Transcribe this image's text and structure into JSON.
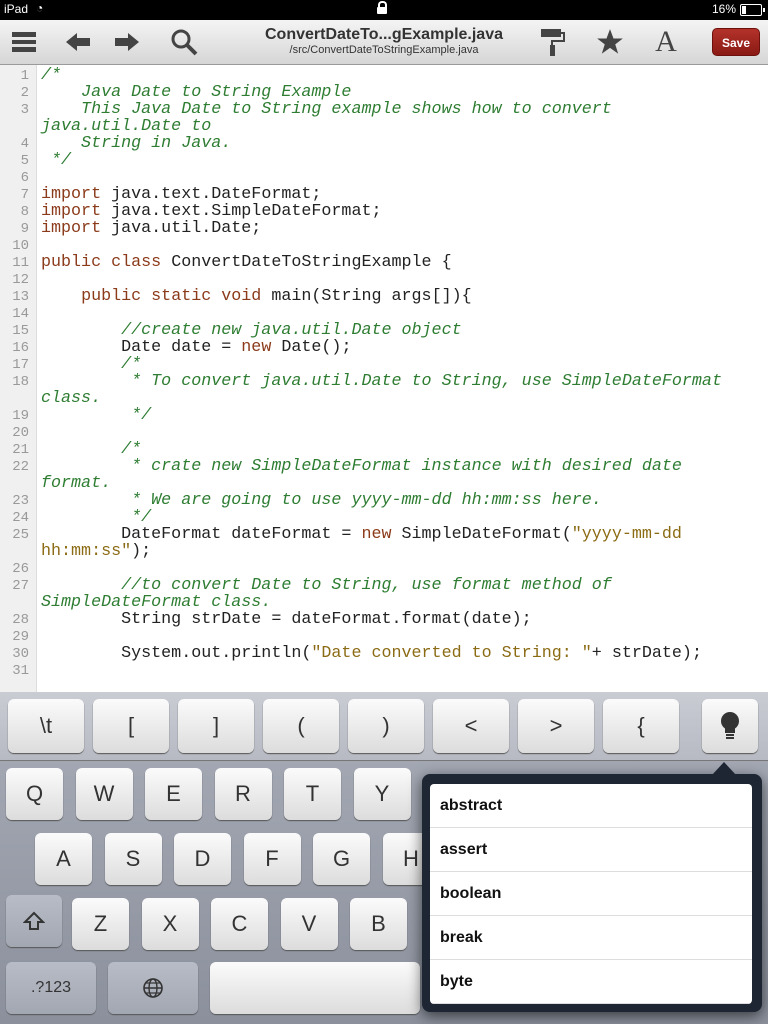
{
  "status": {
    "device": "iPad",
    "battery": "16%"
  },
  "toolbar": {
    "title": "ConvertDateTo...gExample.java",
    "path": "/src/ConvertDateToStringExample.java",
    "save_label": "Save",
    "icons": [
      "menu-icon",
      "back-icon",
      "forward-icon",
      "search-icon",
      "paint-roller-icon",
      "star-icon",
      "font-icon"
    ]
  },
  "code": {
    "lines": [
      {
        "n": "1",
        "parts": [
          [
            "cm",
            "/*"
          ]
        ]
      },
      {
        "n": "2",
        "parts": [
          [
            "cm",
            "    Java Date to String Example"
          ]
        ]
      },
      {
        "n": "3",
        "parts": [
          [
            "cm",
            "    This Java Date to String example shows how to convert"
          ]
        ]
      },
      {
        "n": "",
        "parts": [
          [
            "cm",
            "java.util.Date to"
          ]
        ]
      },
      {
        "n": "4",
        "parts": [
          [
            "cm",
            "    String in Java."
          ]
        ]
      },
      {
        "n": "5",
        "parts": [
          [
            "cm",
            " */"
          ]
        ]
      },
      {
        "n": "6",
        "parts": []
      },
      {
        "n": "7",
        "parts": [
          [
            "kw",
            "import"
          ],
          [
            "",
            "java.text.DateFormat;"
          ]
        ]
      },
      {
        "n": "8",
        "parts": [
          [
            "kw",
            "import"
          ],
          [
            "",
            "java.text.SimpleDateFormat;"
          ]
        ]
      },
      {
        "n": "9",
        "parts": [
          [
            "kw",
            "import"
          ],
          [
            "",
            "java.util.Date;"
          ]
        ]
      },
      {
        "n": "10",
        "parts": []
      },
      {
        "n": "11",
        "parts": [
          [
            "kw",
            "public class"
          ],
          [
            "",
            "ConvertDateToStringExample {"
          ]
        ]
      },
      {
        "n": "12",
        "parts": []
      },
      {
        "n": "13",
        "parts": [
          [
            "",
            "    "
          ],
          [
            "kw",
            "public static void"
          ],
          [
            "",
            "main(String args[]){"
          ]
        ]
      },
      {
        "n": "14",
        "parts": []
      },
      {
        "n": "15",
        "parts": [
          [
            "cm",
            "        //create new java.util.Date object"
          ]
        ]
      },
      {
        "n": "16",
        "parts": [
          [
            "",
            "        Date date = "
          ],
          [
            "kw",
            "new"
          ],
          [
            "",
            "Date();"
          ]
        ]
      },
      {
        "n": "17",
        "parts": [
          [
            "cm",
            "        /*"
          ]
        ]
      },
      {
        "n": "18",
        "parts": [
          [
            "cm",
            "         * To convert java.util.Date to String, use SimpleDateFormat"
          ]
        ]
      },
      {
        "n": "",
        "parts": [
          [
            "cm",
            "class."
          ]
        ]
      },
      {
        "n": "19",
        "parts": [
          [
            "cm",
            "         */"
          ]
        ]
      },
      {
        "n": "20",
        "parts": []
      },
      {
        "n": "21",
        "parts": [
          [
            "cm",
            "        /*"
          ]
        ]
      },
      {
        "n": "22",
        "parts": [
          [
            "cm",
            "         * crate new SimpleDateFormat instance with desired date"
          ]
        ]
      },
      {
        "n": "",
        "parts": [
          [
            "cm",
            "format."
          ]
        ]
      },
      {
        "n": "23",
        "parts": [
          [
            "cm",
            "         * We are going to use yyyy-mm-dd hh:mm:ss here."
          ]
        ]
      },
      {
        "n": "24",
        "parts": [
          [
            "cm",
            "         */"
          ]
        ]
      },
      {
        "n": "25",
        "parts": [
          [
            "",
            "        DateFormat dateFormat = "
          ],
          [
            "kw",
            "new"
          ],
          [
            "",
            "SimpleDateFormat("
          ],
          [
            "st",
            "\"yyyy-mm-dd"
          ]
        ]
      },
      {
        "n": "",
        "parts": [
          [
            "st",
            "hh:mm:ss\""
          ],
          [
            "",
            ");"
          ]
        ]
      },
      {
        "n": "26",
        "parts": []
      },
      {
        "n": "27",
        "parts": [
          [
            "cm",
            "        //to convert Date to String, use format method of"
          ]
        ]
      },
      {
        "n": "",
        "parts": [
          [
            "cm",
            "SimpleDateFormat class."
          ]
        ]
      },
      {
        "n": "28",
        "parts": [
          [
            "",
            "        String strDate = dateFormat.format(date);"
          ]
        ]
      },
      {
        "n": "29",
        "parts": []
      },
      {
        "n": "30",
        "parts": [
          [
            "",
            "        System.out.println("
          ],
          [
            "st",
            "\"Date converted to String: \""
          ],
          [
            "",
            ""
          ],
          [
            "",
            "+ strDate);"
          ]
        ]
      },
      {
        "n": "31",
        "parts": []
      }
    ]
  },
  "extra_keys": [
    "\\t",
    "[",
    "]",
    "(",
    ")",
    "<",
    ">",
    "{"
  ],
  "keyboard": {
    "row1": [
      "Q",
      "W",
      "E",
      "R",
      "T",
      "Y"
    ],
    "row2": [
      "A",
      "S",
      "D",
      "F",
      "G",
      "H"
    ],
    "row3": [
      "Z",
      "X",
      "C",
      "V",
      "B"
    ],
    "numbers_label": ".?123"
  },
  "suggestions": [
    "abstract",
    "assert",
    "boolean",
    "break",
    "byte"
  ]
}
